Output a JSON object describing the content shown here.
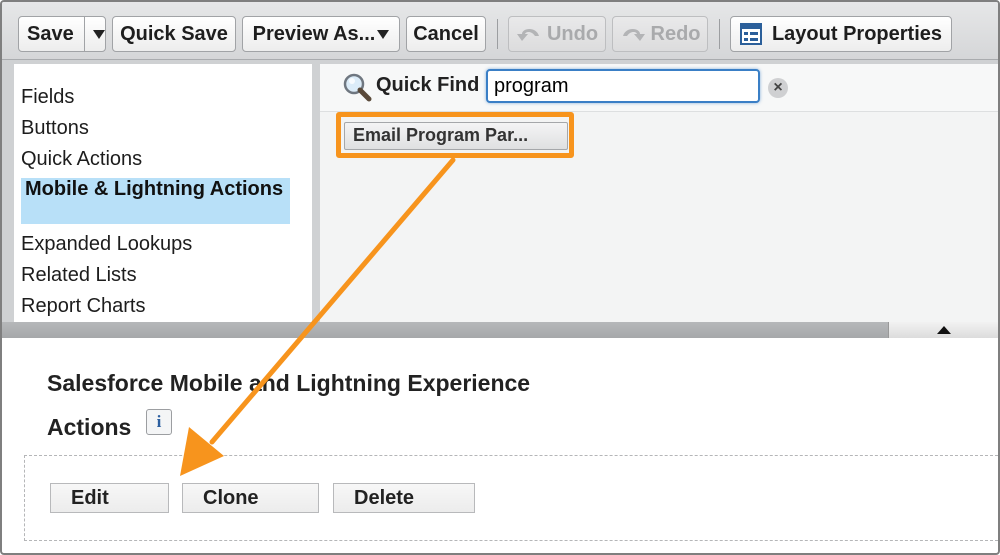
{
  "toolbar": {
    "save": "Save",
    "quick_save": "Quick Save",
    "preview_as": "Preview As...",
    "cancel": "Cancel",
    "undo": "Undo",
    "redo": "Redo",
    "layout_properties": "Layout Properties"
  },
  "sidebar": {
    "items": [
      {
        "label": "Fields",
        "selected": false
      },
      {
        "label": "Buttons",
        "selected": false
      },
      {
        "label": "Quick Actions",
        "selected": false
      },
      {
        "label": "Mobile & Lightning Actions",
        "selected": true
      },
      {
        "label": "Expanded Lookups",
        "selected": false
      },
      {
        "label": "Related Lists",
        "selected": false
      },
      {
        "label": "Report Charts",
        "selected": false
      }
    ]
  },
  "quick_find": {
    "label": "Quick Find",
    "value": "program"
  },
  "palette_results": [
    {
      "label": "Email Program Par..."
    }
  ],
  "section": {
    "title_line1": "Salesforce Mobile and Lightning Experience",
    "title_line2": "Actions",
    "info_glyph": "i"
  },
  "actions": [
    {
      "label": "Edit"
    },
    {
      "label": "Clone"
    },
    {
      "label": "Delete"
    }
  ],
  "colors": {
    "highlight": "#f7941d",
    "selected_bg": "#b8e0f8",
    "focus": "#3a7fc6"
  }
}
